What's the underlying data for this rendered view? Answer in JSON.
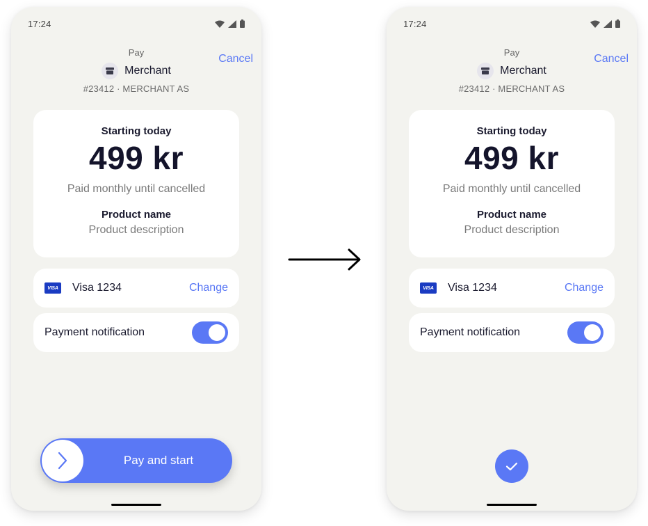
{
  "screens": [
    {
      "state": "before",
      "status_bar": {
        "time": "17:24",
        "icons": [
          "wifi-icon",
          "cellular-signal-icon",
          "battery-icon"
        ]
      },
      "header": {
        "title": "Pay",
        "merchant_name": "Merchant",
        "merchant_ref": "#23412 · MERCHANT AS",
        "merchant_icon": "storefront-icon",
        "cancel_label": "Cancel"
      },
      "summary": {
        "starting": "Starting today",
        "amount": "499 kr",
        "period": "Paid monthly until cancelled",
        "product_name": "Product name",
        "product_description": "Product description"
      },
      "payment_method": {
        "badge": "VISA",
        "label": "Visa 1234",
        "change_label": "Change"
      },
      "notification": {
        "label": "Payment notification",
        "enabled": true
      },
      "action": {
        "label": "Pay and start",
        "icon": "chevron-right-icon"
      }
    },
    {
      "state": "after",
      "status_bar": {
        "time": "17:24",
        "icons": [
          "wifi-icon",
          "cellular-signal-icon",
          "battery-icon"
        ]
      },
      "header": {
        "title": "Pay",
        "merchant_name": "Merchant",
        "merchant_ref": "#23412 · MERCHANT AS",
        "merchant_icon": "storefront-icon",
        "cancel_label": "Cancel"
      },
      "summary": {
        "starting": "Starting today",
        "amount": "499 kr",
        "period": "Paid monthly until cancelled",
        "product_name": "Product name",
        "product_description": "Product description"
      },
      "payment_method": {
        "badge": "VISA",
        "label": "Visa 1234",
        "change_label": "Change"
      },
      "notification": {
        "label": "Payment notification",
        "enabled": true
      },
      "action": {
        "icon": "checkmark-icon"
      }
    }
  ],
  "flow_arrow": "arrow-right-icon",
  "colors": {
    "accent": "#5a78f5",
    "background": "#f3f3ef",
    "card": "#ffffff",
    "visa": "#1a3bc2",
    "text": "#1a1a2e",
    "muted": "#7a7a7a"
  }
}
